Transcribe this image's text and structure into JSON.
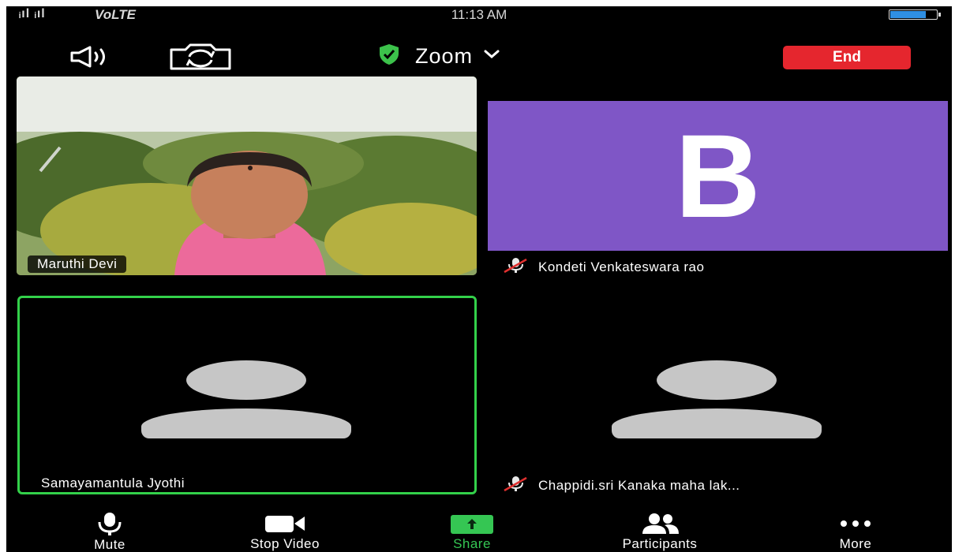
{
  "status_bar": {
    "signal_text": "ᵢıl ᵢıl",
    "carrier": "VoLTE",
    "time": "11:13 AM",
    "battery_level": 0.75
  },
  "top_bar": {
    "speaker_icon": "speaker-icon",
    "camera_switch_icon": "camera-switch-icon",
    "shield_icon": "shield-icon",
    "title": "Zoom",
    "end_label": "End"
  },
  "participants": [
    {
      "name": "Maruthi Devi",
      "video": "on",
      "muted": false
    },
    {
      "name": "Kondeti Venkateswara rao",
      "initial": "B",
      "avatar_color": "#7f56c6",
      "muted": true
    },
    {
      "name": "Samayamantula Jyothi",
      "video": "off",
      "active_speaker": true,
      "muted": false
    },
    {
      "name": "Chappidi.sri Kanaka maha lak...",
      "video": "off",
      "muted": true
    }
  ],
  "toolbar": {
    "items": [
      {
        "label": "Mute",
        "icon": "microphone-icon"
      },
      {
        "label": "Stop Video",
        "icon": "video-camera-icon"
      },
      {
        "label": "Share",
        "icon": "share-arrow-icon"
      },
      {
        "label": "Participants",
        "icon": "participants-icon"
      },
      {
        "label": "More",
        "icon": "more-dots-icon"
      }
    ]
  },
  "colors": {
    "background": "#000000",
    "end_button": "#e5262e",
    "active_speaker_border": "#33d14a",
    "share_green": "#35c653",
    "shield_green": "#3cc24b",
    "avatar_gray": "#c6c6c6"
  }
}
